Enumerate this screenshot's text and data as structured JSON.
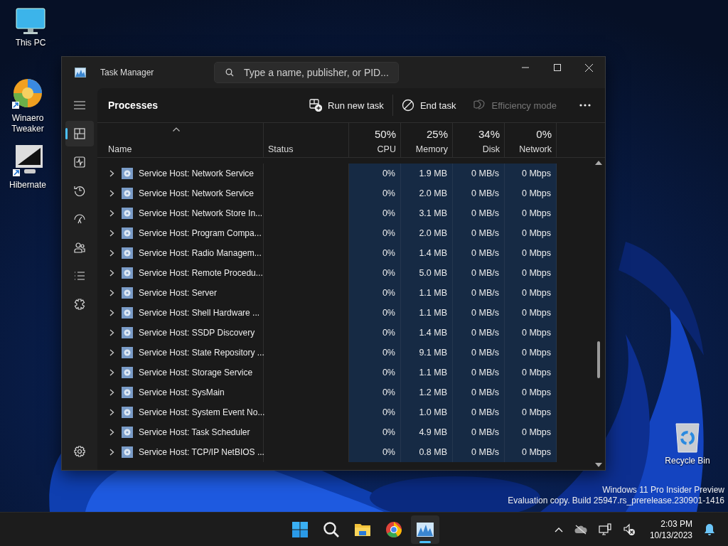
{
  "desktop_icons": [
    {
      "label": "This PC",
      "kind": "pc"
    },
    {
      "label": "Winaero Tweaker",
      "kind": "tweaker"
    },
    {
      "label": "Hibernate",
      "kind": "hibernate"
    },
    {
      "label": "Recycle Bin",
      "kind": "recycle"
    }
  ],
  "window": {
    "title": "Task Manager",
    "search": {
      "placeholder": "Type a name, publisher, or PID..."
    }
  },
  "nav": [
    {
      "kind": "processes",
      "selected": true
    },
    {
      "kind": "performance",
      "selected": false
    },
    {
      "kind": "history",
      "selected": false
    },
    {
      "kind": "startup",
      "selected": false
    },
    {
      "kind": "users",
      "selected": false
    },
    {
      "kind": "details",
      "selected": false
    },
    {
      "kind": "services",
      "selected": false
    }
  ],
  "page_title": "Processes",
  "actions": [
    {
      "label": "Run new task",
      "kind": "run",
      "disabled": false
    },
    {
      "label": "End task",
      "kind": "end",
      "disabled": false
    },
    {
      "label": "Efficiency mode",
      "kind": "efficiency",
      "disabled": true
    }
  ],
  "columns": [
    {
      "label": "Name",
      "sorted": true
    },
    {
      "label": "Status"
    },
    {
      "percent": "50%",
      "label": "CPU"
    },
    {
      "percent": "25%",
      "label": "Memory"
    },
    {
      "percent": "34%",
      "label": "Disk"
    },
    {
      "percent": "0%",
      "label": "Network"
    }
  ],
  "rows": [
    {
      "name": "Service Host: Network Service",
      "cpu": "0%",
      "memory": "1.9 MB",
      "disk": "0 MB/s",
      "network": "0 Mbps"
    },
    {
      "name": "Service Host: Network Service",
      "cpu": "0%",
      "memory": "2.0 MB",
      "disk": "0 MB/s",
      "network": "0 Mbps"
    },
    {
      "name": "Service Host: Network Store In...",
      "cpu": "0%",
      "memory": "3.1 MB",
      "disk": "0 MB/s",
      "network": "0 Mbps"
    },
    {
      "name": "Service Host: Program Compa...",
      "cpu": "0%",
      "memory": "2.0 MB",
      "disk": "0 MB/s",
      "network": "0 Mbps"
    },
    {
      "name": "Service Host: Radio Managem...",
      "cpu": "0%",
      "memory": "1.4 MB",
      "disk": "0 MB/s",
      "network": "0 Mbps"
    },
    {
      "name": "Service Host: Remote Procedu...",
      "cpu": "0%",
      "memory": "5.0 MB",
      "disk": "0 MB/s",
      "network": "0 Mbps"
    },
    {
      "name": "Service Host: Server",
      "cpu": "0%",
      "memory": "1.1 MB",
      "disk": "0 MB/s",
      "network": "0 Mbps"
    },
    {
      "name": "Service Host: Shell Hardware ...",
      "cpu": "0%",
      "memory": "1.1 MB",
      "disk": "0 MB/s",
      "network": "0 Mbps"
    },
    {
      "name": "Service Host: SSDP Discovery",
      "cpu": "0%",
      "memory": "1.4 MB",
      "disk": "0 MB/s",
      "network": "0 Mbps"
    },
    {
      "name": "Service Host: State Repository ...",
      "cpu": "0%",
      "memory": "9.1 MB",
      "disk": "0 MB/s",
      "network": "0 Mbps"
    },
    {
      "name": "Service Host: Storage Service",
      "cpu": "0%",
      "memory": "1.1 MB",
      "disk": "0 MB/s",
      "network": "0 Mbps"
    },
    {
      "name": "Service Host: SysMain",
      "cpu": "0%",
      "memory": "1.2 MB",
      "disk": "0 MB/s",
      "network": "0 Mbps"
    },
    {
      "name": "Service Host: System Event No...",
      "cpu": "0%",
      "memory": "1.0 MB",
      "disk": "0 MB/s",
      "network": "0 Mbps"
    },
    {
      "name": "Service Host: Task Scheduler",
      "cpu": "0%",
      "memory": "4.9 MB",
      "disk": "0 MB/s",
      "network": "0 Mbps"
    },
    {
      "name": "Service Host: TCP/IP NetBIOS ...",
      "cpu": "0%",
      "memory": "0.8 MB",
      "disk": "0 MB/s",
      "network": "0 Mbps"
    }
  ],
  "os_notice": [
    "Windows 11 Pro Insider Preview",
    "Evaluation copy. Build 25947.rs_prerelease.230901-1416"
  ],
  "taskbar": {
    "apps": [
      {
        "kind": "start",
        "active": false
      },
      {
        "kind": "search",
        "active": false
      },
      {
        "kind": "explorer",
        "active": false
      },
      {
        "kind": "chrome",
        "active": false
      },
      {
        "kind": "taskmanager",
        "active": true
      }
    ],
    "time": "2:03 PM",
    "date": "10/13/2023"
  }
}
